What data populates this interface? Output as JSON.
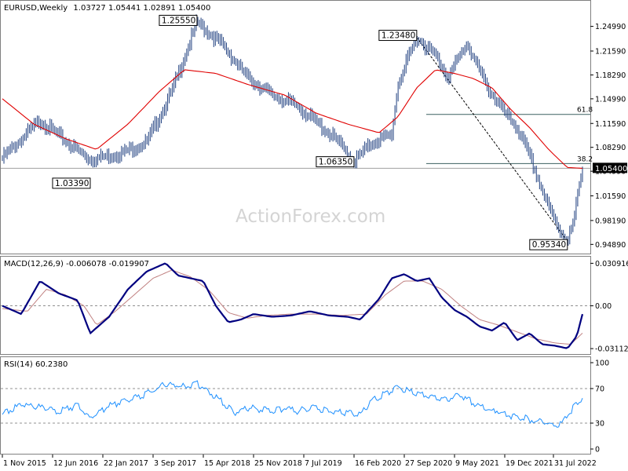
{
  "watermark": "ActionForex.com",
  "chart_data": [
    {
      "type": "candlestick",
      "title": "EURUSD,Weekly",
      "ohlc_text": "1.03727 1.05441 1.02891 1.05400",
      "last_price": "1.05400",
      "ylim": [
        0.9395,
        1.2755
      ],
      "y_ticks": [
        "1.24990",
        "1.21590",
        "1.18290",
        "1.14990",
        "1.11590",
        "1.08290",
        "1.04990",
        "1.01590",
        "0.98190",
        "0.94890"
      ],
      "x_ticks": [
        "1 Nov 2015",
        "12 Jun 2016",
        "22 Jan 2017",
        "3 Sep 2017",
        "15 Apr 2018",
        "25 Nov 2018",
        "7 Jul 2019",
        "16 Feb 2020",
        "27 Sep 2020",
        "9 May 2021",
        "19 Dec 2021",
        "31 Jul 2022"
      ],
      "price_path": [
        [
          0,
          1.068
        ],
        [
          6,
          1.12
        ],
        [
          11,
          1.085
        ],
        [
          14,
          1.066
        ],
        [
          19,
          1.075
        ],
        [
          23,
          1.09
        ],
        [
          27,
          1.16
        ],
        [
          31,
          1.2555
        ],
        [
          35,
          1.225
        ],
        [
          39,
          1.18
        ],
        [
          43,
          1.155
        ],
        [
          47,
          1.14
        ],
        [
          51,
          1.11
        ],
        [
          53,
          1.095
        ],
        [
          56,
          1.0635
        ],
        [
          59,
          1.09
        ],
        [
          62,
          1.1
        ],
        [
          63,
          1.17
        ],
        [
          66,
          1.2348
        ],
        [
          69,
          1.21
        ],
        [
          71,
          1.18
        ],
        [
          74,
          1.2266
        ],
        [
          77,
          1.17
        ],
        [
          80,
          1.13
        ],
        [
          82,
          1.11
        ],
        [
          84,
          1.07
        ],
        [
          87,
          1.0
        ],
        [
          89,
          0.965
        ],
        [
          90,
          0.9534
        ],
        [
          91,
          0.98
        ],
        [
          92,
          1.03727
        ],
        [
          92.4,
          1.054
        ]
      ],
      "ma_path": [
        [
          0,
          1.15
        ],
        [
          5,
          1.115
        ],
        [
          10,
          1.095
        ],
        [
          15,
          1.08
        ],
        [
          20,
          1.115
        ],
        [
          25,
          1.16
        ],
        [
          29,
          1.19
        ],
        [
          34,
          1.185
        ],
        [
          39,
          1.17
        ],
        [
          45,
          1.155
        ],
        [
          50,
          1.13
        ],
        [
          55,
          1.115
        ],
        [
          60,
          1.103
        ],
        [
          63,
          1.125
        ],
        [
          66,
          1.165
        ],
        [
          69,
          1.19
        ],
        [
          72,
          1.185
        ],
        [
          75,
          1.178
        ],
        [
          78,
          1.165
        ],
        [
          81,
          1.135
        ],
        [
          84,
          1.11
        ],
        [
          87,
          1.08
        ],
        [
          90,
          1.055
        ],
        [
          92.4,
          1.054
        ]
      ],
      "fib_levels": [
        {
          "label": "61.8",
          "value": 1.1284
        },
        {
          "label": "38.2",
          "value": 1.0605
        }
      ],
      "horizontal_line": 1.054,
      "trendline": [
        [
          66,
          1.2348
        ],
        [
          90,
          0.9534
        ]
      ],
      "annotations": [
        {
          "text": "1.25550",
          "x": 31,
          "value": 1.2555,
          "side": "left"
        },
        {
          "text": "1.23480",
          "x": 66,
          "value": 1.2348,
          "side": "left"
        },
        {
          "text": "1.06350",
          "x": 56,
          "value": 1.0635,
          "side": "left"
        },
        {
          "text": "1.03390",
          "x": 14,
          "value": 1.0339,
          "side": "left"
        },
        {
          "text": "0.95340",
          "x": 90,
          "value": 0.9534,
          "side": "left"
        }
      ],
      "colors": {
        "ma": "#e00000",
        "candle": "#1f3f7f",
        "last": "#000000"
      }
    },
    {
      "type": "line",
      "title": "MACD(12,26,9) -0.006078 -0.019907",
      "ylim": [
        -0.0345,
        0.034
      ],
      "y_ticks": [
        "0.030916",
        "0.00",
        "-0.031124"
      ],
      "series": [
        {
          "name": "MACD",
          "color": "#000080",
          "values": [
            [
              0,
              0.0
            ],
            [
              3,
              -0.006
            ],
            [
              6,
              0.018
            ],
            [
              9,
              0.009
            ],
            [
              12,
              0.004
            ],
            [
              14,
              -0.02
            ],
            [
              17,
              -0.008
            ],
            [
              20,
              0.012
            ],
            [
              23,
              0.025
            ],
            [
              26,
              0.031
            ],
            [
              28,
              0.022
            ],
            [
              30,
              0.02
            ],
            [
              32,
              0.018
            ],
            [
              34,
              0.0
            ],
            [
              36,
              -0.012
            ],
            [
              38,
              -0.01
            ],
            [
              40,
              -0.006
            ],
            [
              43,
              -0.008
            ],
            [
              46,
              -0.007
            ],
            [
              49,
              -0.004
            ],
            [
              52,
              -0.007
            ],
            [
              55,
              -0.008
            ],
            [
              57,
              -0.01
            ],
            [
              60,
              0.005
            ],
            [
              62,
              0.02
            ],
            [
              64,
              0.023
            ],
            [
              66,
              0.018
            ],
            [
              68,
              0.02
            ],
            [
              70,
              0.006
            ],
            [
              72,
              -0.003
            ],
            [
              74,
              -0.008
            ],
            [
              76,
              -0.015
            ],
            [
              78,
              -0.018
            ],
            [
              80,
              -0.012
            ],
            [
              82,
              -0.025
            ],
            [
              84,
              -0.02
            ],
            [
              86,
              -0.028
            ],
            [
              88,
              -0.029
            ],
            [
              90,
              -0.031
            ],
            [
              91.5,
              -0.022
            ],
            [
              92.4,
              -0.006078
            ]
          ]
        },
        {
          "name": "Signal",
          "color": "#c08080",
          "values": [
            [
              0,
              -0.002
            ],
            [
              4,
              -0.004
            ],
            [
              7,
              0.012
            ],
            [
              10,
              0.008
            ],
            [
              13,
              0.0
            ],
            [
              15,
              -0.014
            ],
            [
              18,
              -0.004
            ],
            [
              21,
              0.008
            ],
            [
              24,
              0.02
            ],
            [
              27,
              0.026
            ],
            [
              30,
              0.021
            ],
            [
              33,
              0.011
            ],
            [
              36,
              -0.005
            ],
            [
              39,
              -0.009
            ],
            [
              42,
              -0.007
            ],
            [
              46,
              -0.006
            ],
            [
              50,
              -0.006
            ],
            [
              54,
              -0.007
            ],
            [
              58,
              -0.006
            ],
            [
              61,
              0.008
            ],
            [
              64,
              0.018
            ],
            [
              67,
              0.018
            ],
            [
              70,
              0.012
            ],
            [
              73,
              0.0
            ],
            [
              76,
              -0.01
            ],
            [
              79,
              -0.014
            ],
            [
              82,
              -0.019
            ],
            [
              85,
              -0.024
            ],
            [
              88,
              -0.027
            ],
            [
              90.5,
              -0.028
            ],
            [
              92.4,
              -0.019907
            ]
          ]
        }
      ],
      "zero_line": 0.0
    },
    {
      "type": "line",
      "title": "RSI(14) 60.2380",
      "ylim": [
        0,
        100
      ],
      "y_ticks": [
        "100",
        "70",
        "30",
        "0"
      ],
      "levels": [
        70,
        30
      ],
      "series": [
        {
          "name": "RSI",
          "color": "#1e90ff",
          "values": [
            [
              0,
              40
            ],
            [
              3,
              52
            ],
            [
              6,
              48
            ],
            [
              9,
              44
            ],
            [
              12,
              50
            ],
            [
              14,
              36
            ],
            [
              17,
              50
            ],
            [
              20,
              57
            ],
            [
              23,
              64
            ],
            [
              26,
              75
            ],
            [
              29,
              72
            ],
            [
              31,
              76
            ],
            [
              33,
              66
            ],
            [
              35,
              55
            ],
            [
              37,
              42
            ],
            [
              39,
              48
            ],
            [
              41,
              46
            ],
            [
              43,
              44
            ],
            [
              45,
              47
            ],
            [
              47,
              44
            ],
            [
              49,
              48
            ],
            [
              51,
              46
            ],
            [
              53,
              44
            ],
            [
              55,
              42
            ],
            [
              57,
              40
            ],
            [
              59,
              56
            ],
            [
              61,
              64
            ],
            [
              63,
              72
            ],
            [
              65,
              66
            ],
            [
              67,
              64
            ],
            [
              69,
              60
            ],
            [
              71,
              58
            ],
            [
              73,
              62
            ],
            [
              75,
              54
            ],
            [
              77,
              46
            ],
            [
              79,
              44
            ],
            [
              81,
              38
            ],
            [
              83,
              36
            ],
            [
              85,
              32
            ],
            [
              87,
              30
            ],
            [
              89,
              28
            ],
            [
              91,
              48
            ],
            [
              92.4,
              60.238
            ]
          ]
        }
      ]
    }
  ]
}
